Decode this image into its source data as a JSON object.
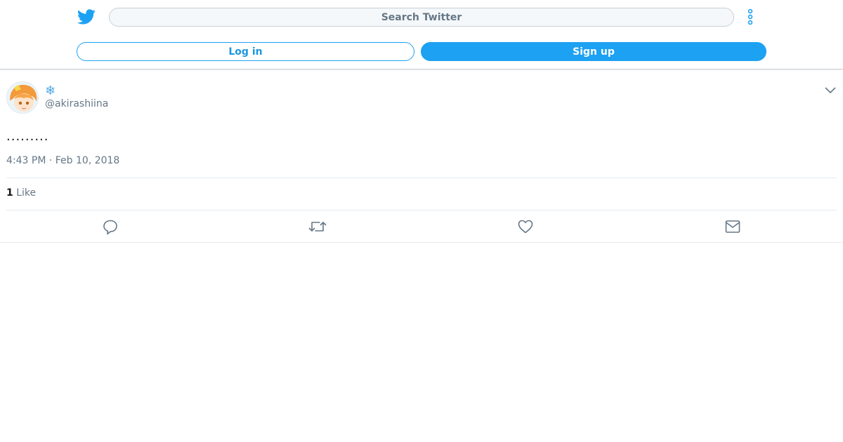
{
  "header": {
    "search_placeholder": "Search Twitter",
    "login_label": "Log in",
    "signup_label": "Sign up",
    "logo_icon": "twitter-bird-icon",
    "more_icon": "vertical-dots-icon"
  },
  "tweet": {
    "display_name": "❄",
    "handle": "@akirashiina",
    "text": ".........",
    "timestamp": "4:43 PM · Feb 10, 2018",
    "like_count": "1",
    "like_label": "Like",
    "caret_icon": "chevron-down-icon"
  },
  "actions": [
    {
      "name": "reply",
      "icon": "reply-icon"
    },
    {
      "name": "retweet",
      "icon": "retweet-icon"
    },
    {
      "name": "like",
      "icon": "heart-icon"
    },
    {
      "name": "share",
      "icon": "mail-icon"
    }
  ],
  "colors": {
    "brand": "#1da1f2",
    "text_primary": "#14171a",
    "text_secondary": "#657786",
    "divider": "#e6ecf0"
  }
}
